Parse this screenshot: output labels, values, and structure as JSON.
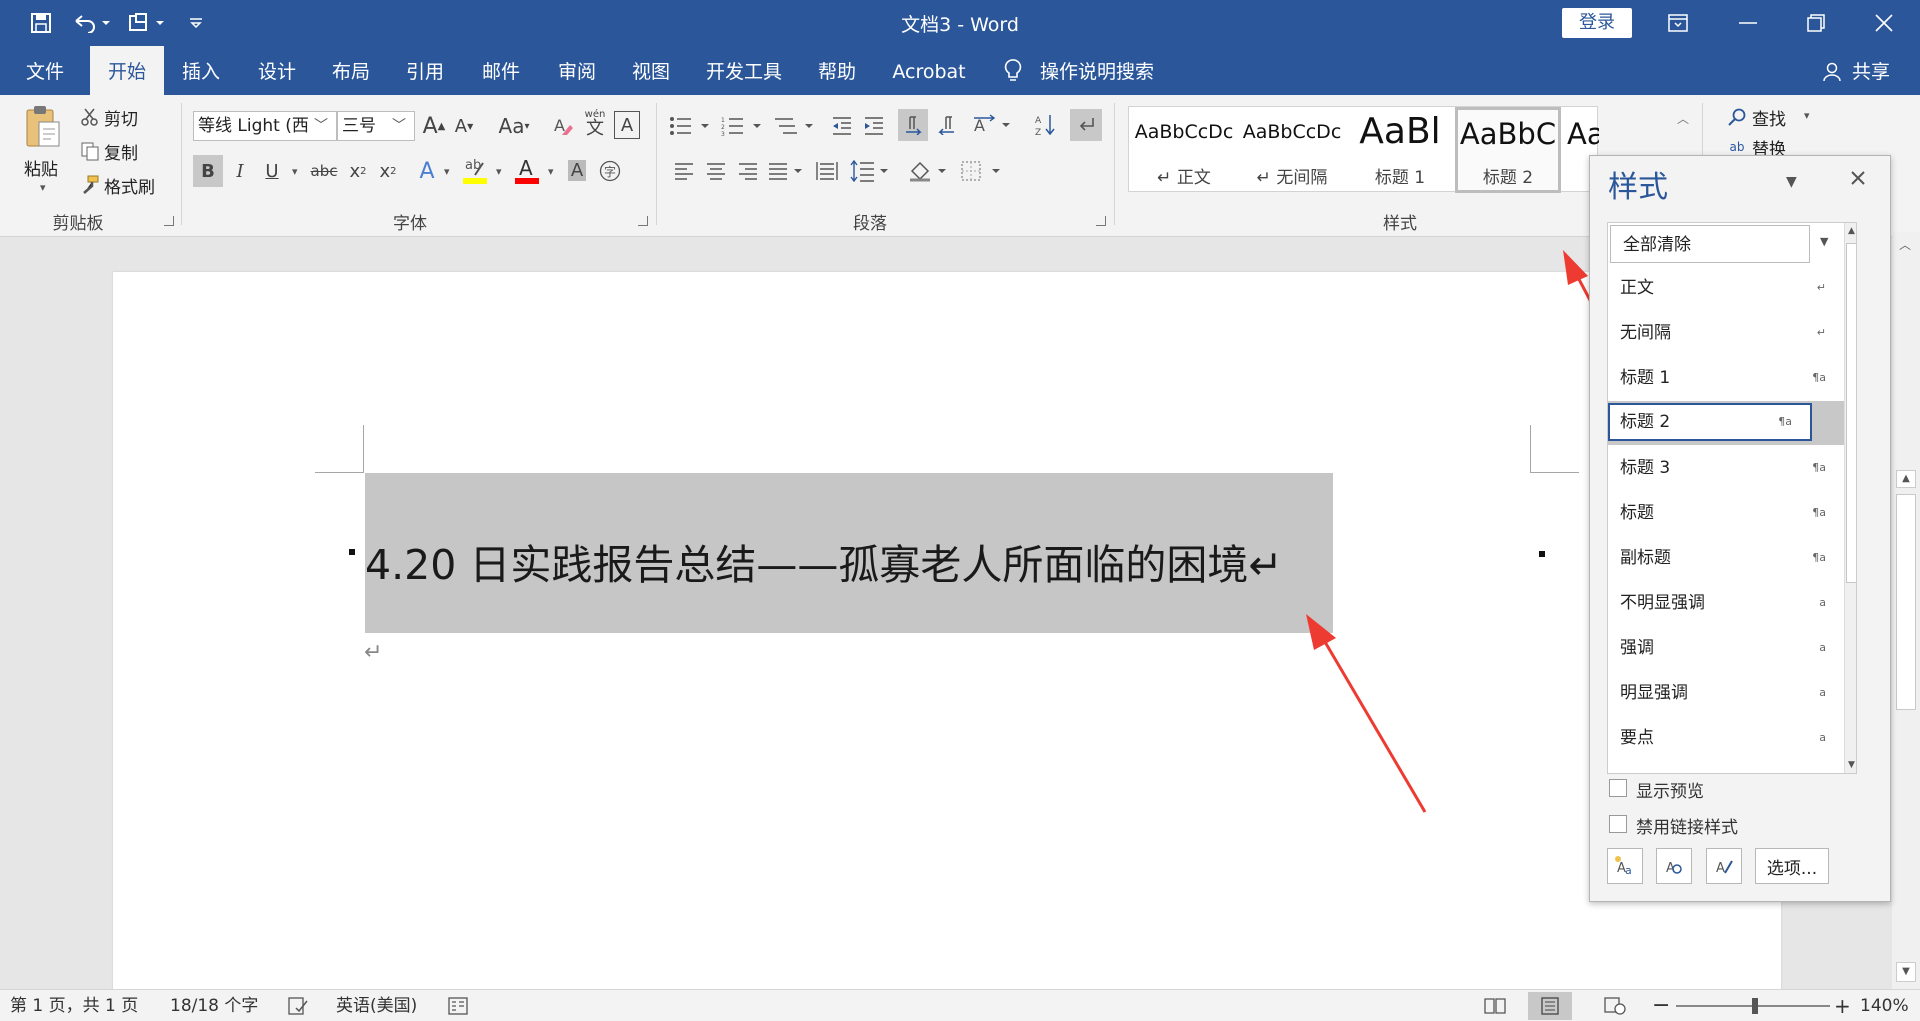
{
  "window": {
    "title": "文档3  -  Word",
    "login": "登录"
  },
  "tabs": [
    "文件",
    "开始",
    "插入",
    "设计",
    "布局",
    "引用",
    "邮件",
    "审阅",
    "视图",
    "开发工具",
    "帮助",
    "Acrobat"
  ],
  "tell_me": "操作说明搜索",
  "share": "共享",
  "clipboard": {
    "paste": "粘贴",
    "cut": "剪切",
    "copy": "复制",
    "painter": "格式刷",
    "group": "剪贴板"
  },
  "font": {
    "name": "等线 Light (西",
    "size": "三号",
    "group": "字体",
    "bold": "B",
    "italic": "I",
    "underline": "U",
    "strike": "abc",
    "grow": "A",
    "shrink": "A",
    "case": "Aa",
    "phonetic": "wén",
    "phonetic_char": "文"
  },
  "paragraph": {
    "group": "段落"
  },
  "styles": {
    "group": "样式",
    "gallery": [
      {
        "preview": "AaBbCcDc",
        "name": "↵ 正文"
      },
      {
        "preview": "AaBbCcDc",
        "name": "↵ 无间隔"
      },
      {
        "preview": "AaBl",
        "name": "标题 1"
      },
      {
        "preview": "AaBbC",
        "name": "标题 2"
      },
      {
        "preview": "AaBbC",
        "name": ""
      }
    ]
  },
  "editing": {
    "find": "查找",
    "replace": "替换"
  },
  "document": {
    "heading": "4.20 日实践报告总结——孤寡老人所面临的困境↵",
    "para_mark": "↵"
  },
  "status": {
    "page": "第 1 页，共 1 页",
    "words": "18/18 个字",
    "language": "英语(美国)",
    "zoom": "140%"
  },
  "styles_pane": {
    "title": "样式",
    "items": [
      {
        "name": "全部清除",
        "ind": ""
      },
      {
        "name": "正文",
        "ind": "↵"
      },
      {
        "name": "无间隔",
        "ind": "↵"
      },
      {
        "name": "标题 1",
        "ind": "¶a"
      },
      {
        "name": "标题 2",
        "ind": "¶a"
      },
      {
        "name": "标题 3",
        "ind": "¶a"
      },
      {
        "name": "标题",
        "ind": "¶a"
      },
      {
        "name": "副标题",
        "ind": "¶a"
      },
      {
        "name": "不明显强调",
        "ind": "a"
      },
      {
        "name": "强调",
        "ind": "a"
      },
      {
        "name": "明显强调",
        "ind": "a"
      },
      {
        "name": "要点",
        "ind": "a"
      }
    ],
    "show_preview": "显示预览",
    "disable_linked": "禁用链接样式",
    "options": "选项..."
  },
  "colors": {
    "accent": "#2b579a",
    "highlight": "#ffff00",
    "font_color": "#ff0000",
    "arrow": "#ee3b32"
  }
}
